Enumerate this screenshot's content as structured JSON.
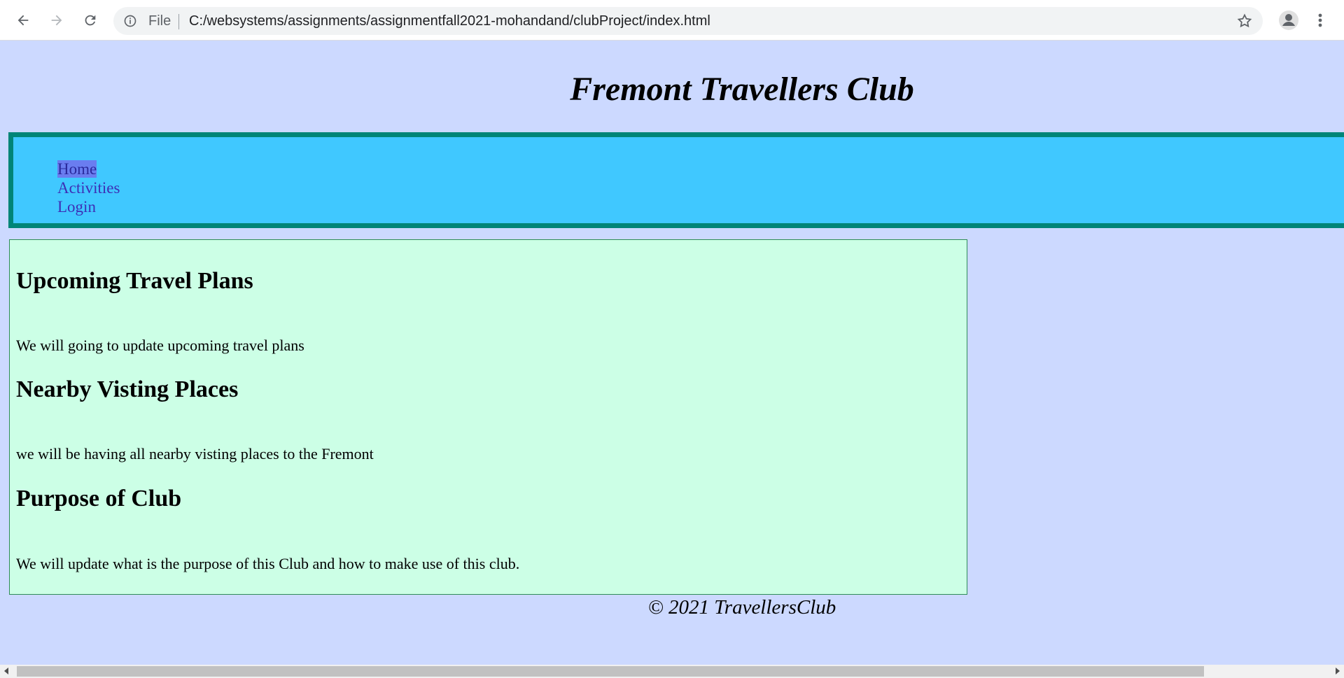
{
  "browser": {
    "back_icon": "arrow-left-icon",
    "forward_icon": "arrow-right-icon",
    "reload_icon": "reload-icon",
    "info_icon": "info-icon",
    "file_label": "File",
    "url": "C:/websystems/assignments/assignmentfall2021-mohandand/clubProject/index.html",
    "star_icon": "star-icon",
    "profile_icon": "profile-icon",
    "menu_icon": "kebab-menu-icon"
  },
  "page": {
    "title": "Fremont Travellers Club",
    "nav": [
      {
        "label": "Home",
        "active": true
      },
      {
        "label": "Activities",
        "active": false
      },
      {
        "label": "Login",
        "active": false
      }
    ],
    "sections": [
      {
        "heading": "Upcoming Travel Plans",
        "text": "We will going to update upcoming travel plans"
      },
      {
        "heading": "Nearby Visting Places",
        "text": "we will be having all nearby visting places to the Fremont"
      },
      {
        "heading": "Purpose of Club",
        "text": "We will update what is the purpose of this Club and how to make use of this club."
      }
    ],
    "footer": "© 2021 TravellersClub"
  },
  "colors": {
    "page_bg": "#ccd9ff",
    "nav_bg": "#40c8ff",
    "nav_border": "#008577",
    "content_bg": "#ccffe6"
  }
}
